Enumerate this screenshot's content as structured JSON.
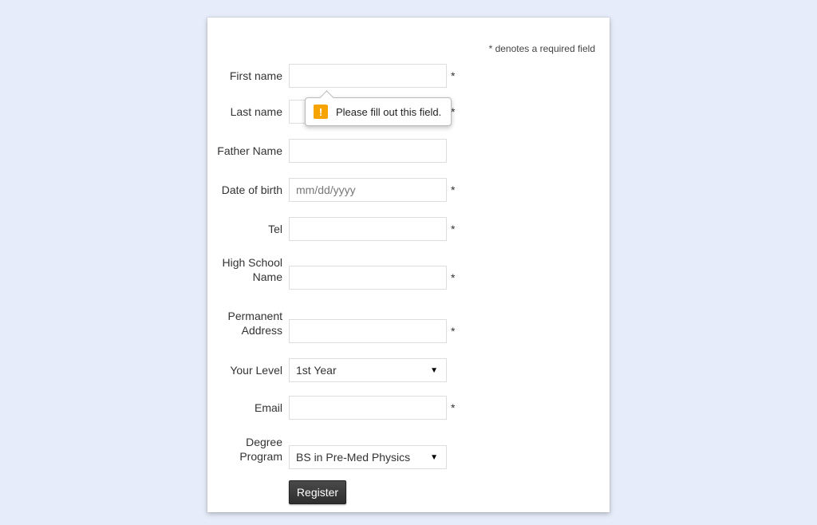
{
  "required_note": "* denotes a required field",
  "asterisk": "*",
  "tooltip": {
    "text": "Please fill out this field."
  },
  "fields": {
    "first_name": {
      "label": "First name",
      "value": "",
      "placeholder": "",
      "required": true
    },
    "last_name": {
      "label": "Last name",
      "value": "",
      "placeholder": "",
      "required": true
    },
    "father_name": {
      "label": "Father Name",
      "value": "",
      "placeholder": "",
      "required": false
    },
    "dob": {
      "label": "Date of birth",
      "value": "",
      "placeholder": "mm/dd/yyyy",
      "required": true
    },
    "tel": {
      "label": "Tel",
      "value": "",
      "placeholder": "",
      "required": true
    },
    "high_school": {
      "label": "High School Name",
      "value": "",
      "placeholder": "",
      "required": true
    },
    "address": {
      "label": "Permanent Address",
      "value": "",
      "placeholder": "",
      "required": true
    },
    "level": {
      "label": "Your Level",
      "value": "1st Year",
      "required": false
    },
    "email": {
      "label": "Email",
      "value": "",
      "placeholder": "",
      "required": true
    },
    "program": {
      "label": "Degree Program",
      "value": "BS in Pre-Med Physics",
      "required": false
    }
  },
  "register_label": "Register"
}
